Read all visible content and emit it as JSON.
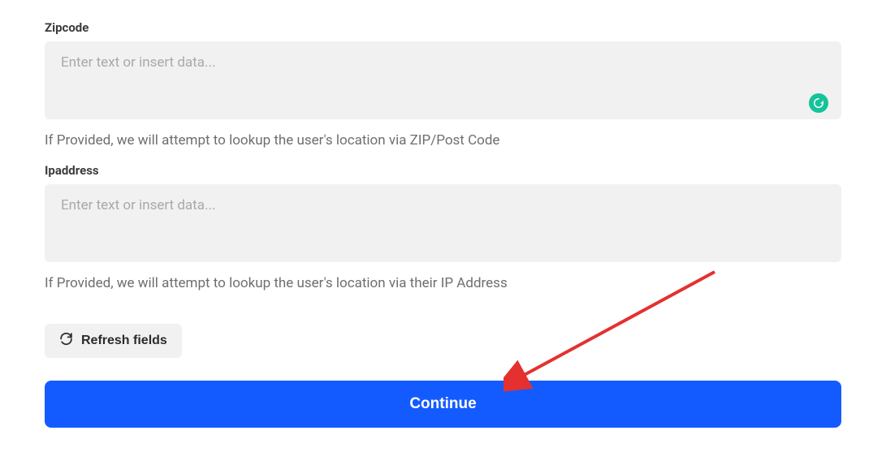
{
  "fields": {
    "zipcode": {
      "label": "Zipcode",
      "placeholder": "Enter text or insert data...",
      "help": "If Provided, we will attempt to lookup the user's location via ZIP/Post Code"
    },
    "ipaddress": {
      "label": "Ipaddress",
      "placeholder": "Enter text or insert data...",
      "help": "If Provided, we will attempt to lookup the user's location via their IP Address"
    }
  },
  "buttons": {
    "refresh": "Refresh fields",
    "continue": "Continue"
  }
}
